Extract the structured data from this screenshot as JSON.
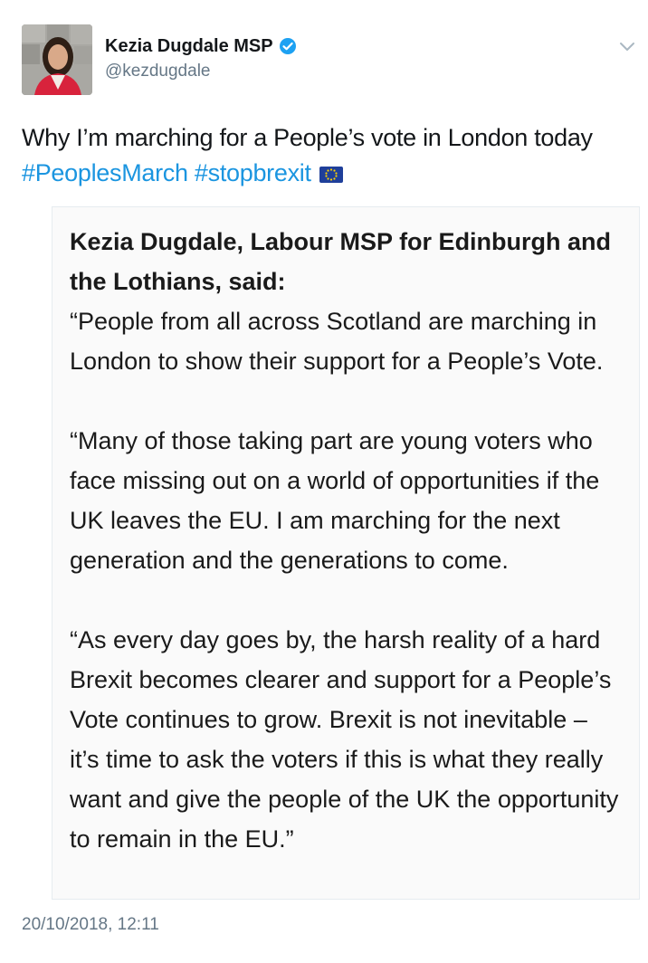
{
  "author": {
    "display_name": "Kezia Dugdale MSP",
    "handle": "@kezdugdale",
    "verified": true,
    "avatar_icon": "profile-photo"
  },
  "tweet": {
    "text": "Why I’m marching for a People’s vote in London today",
    "hashtags": [
      "#PeoplesMarch",
      "#stopbrexit"
    ],
    "emoji": "eu-flag-icon",
    "timestamp": "20/10/2018, 12:11"
  },
  "quote_image": {
    "heading": "Kezia Dugdale, Labour MSP for Edinburgh and the Lothians, said:",
    "paragraphs": [
      "“People from all across Scotland are marching in London to show their support for a People’s Vote.",
      "“Many of those taking part are young voters who face missing out on a world of opportunities if the UK leaves the EU. I am marching for the next generation and the generations to come.",
      "“As every day goes by, the harsh reality of a hard Brexit becomes clearer and support for a People’s Vote continues to grow. Brexit is not inevitable – it’s time to ask the voters if this is what they really want and give the people of the UK the opportunity to remain in the EU.”"
    ]
  },
  "colors": {
    "link": "#1b95e0",
    "secondary_text": "#657786",
    "verified": "#1da1f2",
    "card_background": "#fafafa"
  }
}
